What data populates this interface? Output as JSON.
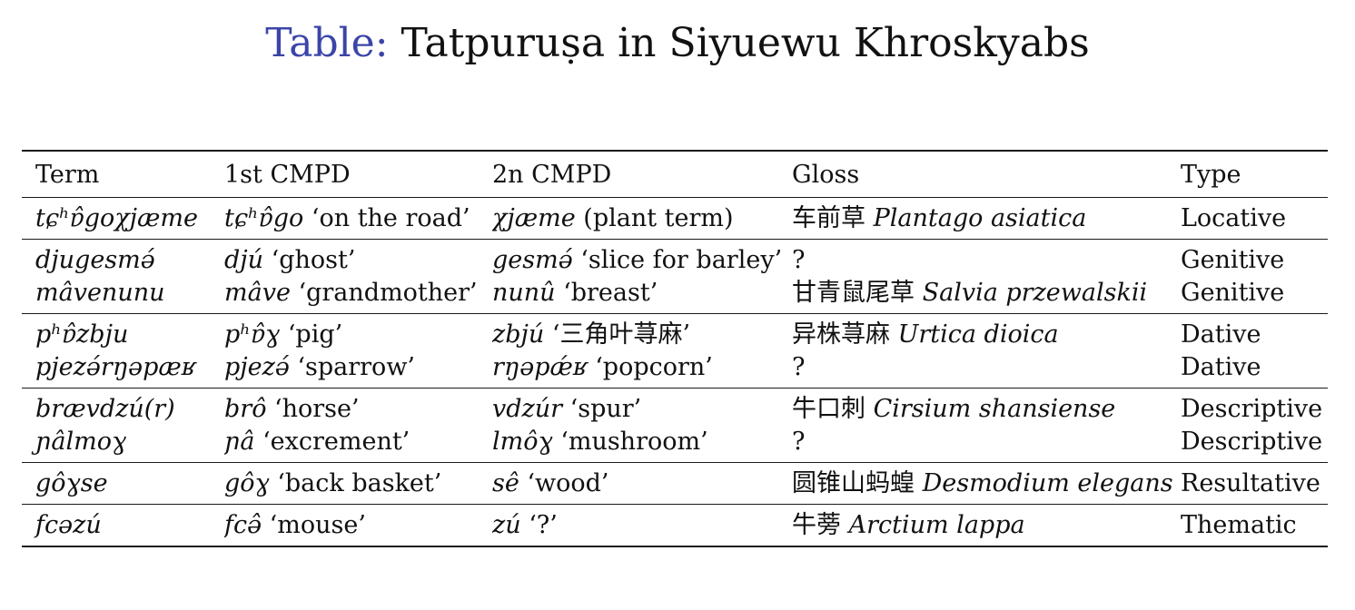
{
  "caption": {
    "label": "Table:",
    "text": "Tatpuruṣa in Siyuewu Khroskyabs"
  },
  "table": {
    "headers": [
      "Term",
      "1st CMPD",
      "2n CMPD",
      "Gloss",
      "Type"
    ],
    "groups": [
      [
        {
          "term": "tɕʰɐ̂goχjæme",
          "first_form": "tɕʰɐ̂go",
          "first_gloss": " ‘on the road’",
          "second_form": "χjæme",
          "second_gloss": " (plant term)",
          "gloss_cn": "车前草 ",
          "gloss_latin": "Plantago asiatica",
          "type": "Locative"
        }
      ],
      [
        {
          "term": "djugesmə́",
          "first_form": "djú",
          "first_gloss": " ‘ghost’",
          "second_form": "gesmə́",
          "second_gloss": " ‘slice for barley’",
          "gloss_cn": "?",
          "gloss_latin": "",
          "type": "Genitive"
        },
        {
          "term": "mâvenunu",
          "first_form": "mâve",
          "first_gloss": " ‘grandmother’",
          "second_form": "nunû",
          "second_gloss": " ‘breast’",
          "gloss_cn": "甘青鼠尾草 ",
          "gloss_latin": "Salvia przewalskii",
          "type": "Genitive"
        }
      ],
      [
        {
          "term": "pʰɐ̂zbju",
          "first_form": "pʰɐ̂ɣ",
          "first_gloss": " ‘pig’",
          "second_form": "zbjú",
          "second_gloss": " ‘三角叶荨麻’",
          "gloss_cn": "异株荨麻 ",
          "gloss_latin": "Urtica dioica",
          "type": "Dative"
        },
        {
          "term": "pjezə́rŋəpæʁ",
          "first_form": "pjezə́",
          "first_gloss": " ‘sparrow’",
          "second_form": "rŋəpǽʁ",
          "second_gloss": " ‘popcorn’",
          "gloss_cn": "?",
          "gloss_latin": "",
          "type": "Dative"
        }
      ],
      [
        {
          "term": "brævdzú(r)",
          "first_form": "brô",
          "first_gloss": " ‘horse’",
          "second_form": "vdzúr",
          "second_gloss": " ‘spur’",
          "gloss_cn": "牛口刺 ",
          "gloss_latin": "Cirsium shansiense",
          "type": "Descriptive"
        },
        {
          "term": "ɲâlmoɣ",
          "first_form": "ɲâ",
          "first_gloss": " ‘excrement’",
          "second_form": "lmôɣ",
          "second_gloss": " ‘mushroom’",
          "gloss_cn": "?",
          "gloss_latin": "",
          "type": "Descriptive"
        }
      ],
      [
        {
          "term": "gôɣse",
          "first_form": "gôɣ",
          "first_gloss": " ‘back basket’",
          "second_form": "sê",
          "second_gloss": " ‘wood’",
          "gloss_cn": "圆锥山蚂蝗 ",
          "gloss_latin": "Desmodium elegans",
          "type": "Resultative"
        }
      ],
      [
        {
          "term": "fcəzú",
          "first_form": "fcə̂",
          "first_gloss": " ‘mouse’",
          "second_form": "zú",
          "second_gloss": " ‘?’",
          "gloss_cn": "牛蒡 ",
          "gloss_latin": "Arctium lappa",
          "type": "Thematic"
        }
      ]
    ]
  }
}
